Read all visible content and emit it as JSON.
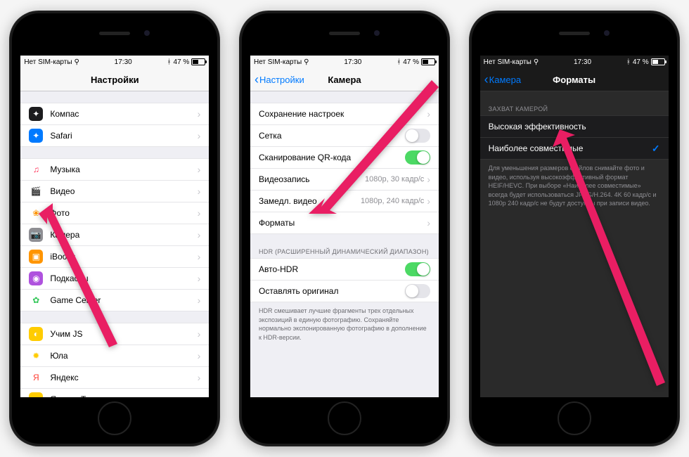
{
  "status": {
    "carrier": "Нет SIM-карты",
    "time": "17:30",
    "battery": "47 %",
    "wifi_icon": "wifi",
    "bt_icon": "bluetooth"
  },
  "phone1": {
    "title": "Настройки",
    "group1": [
      {
        "label": "Компас",
        "icon_bg": "#1c1c1e",
        "icon_glyph": "✦"
      },
      {
        "label": "Safari",
        "icon_bg": "#007aff",
        "icon_glyph": "✦"
      }
    ],
    "group2": [
      {
        "label": "Музыка",
        "icon_bg": "#ffffff",
        "icon_glyph": "♫",
        "icon_color": "#ff2d55"
      },
      {
        "label": "Видео",
        "icon_bg": "#ffffff",
        "icon_glyph": "🎬",
        "icon_color": "#000"
      },
      {
        "label": "Фото",
        "icon_bg": "#ffffff",
        "icon_glyph": "❀",
        "icon_color": "#ff9500"
      },
      {
        "label": "Камера",
        "icon_bg": "#8e8e93",
        "icon_glyph": "📷"
      },
      {
        "label": "iBooks",
        "icon_bg": "#ff9500",
        "icon_glyph": "▣"
      },
      {
        "label": "Подкасты",
        "icon_bg": "#af52de",
        "icon_glyph": "◉"
      },
      {
        "label": "Game Center",
        "icon_bg": "#ffffff",
        "icon_glyph": "✿",
        "icon_color": "#34c759"
      }
    ],
    "group3": [
      {
        "label": "Учим JS",
        "icon_bg": "#ffcc00",
        "icon_glyph": "◐"
      },
      {
        "label": "Юла",
        "icon_bg": "#ffffff",
        "icon_glyph": "✹",
        "icon_color": "#ffcc00"
      },
      {
        "label": "Яндекс",
        "icon_bg": "#ffffff",
        "icon_glyph": "Я",
        "icon_color": "#ff3b30"
      },
      {
        "label": "Яндекс Такси",
        "icon_bg": "#ffcc00",
        "icon_glyph": "▪"
      }
    ]
  },
  "phone2": {
    "back": "Настройки",
    "title": "Камера",
    "group1": [
      {
        "label": "Сохранение настроек",
        "type": "chevron"
      },
      {
        "label": "Сетка",
        "type": "switch",
        "on": false
      },
      {
        "label": "Сканирование QR-кода",
        "type": "switch",
        "on": true
      },
      {
        "label": "Видеозапись",
        "type": "value",
        "value": "1080p, 30 кадр/с"
      },
      {
        "label": "Замедл. видео",
        "type": "value",
        "value": "1080p, 240 кадр/с"
      },
      {
        "label": "Форматы",
        "type": "chevron"
      }
    ],
    "hdr_header": "HDR (РАСШИРЕННЫЙ ДИНАМИЧЕСКИЙ ДИАПАЗОН)",
    "group2": [
      {
        "label": "Авто-HDR",
        "type": "switch",
        "on": true
      },
      {
        "label": "Оставлять оригинал",
        "type": "switch",
        "on": false
      }
    ],
    "hdr_footer": "HDR смешивает лучшие фрагменты трех отдельных экспозиций в единую фотографию. Сохраняйте нормально экспонированную фотографию в дополнение к HDR-версии."
  },
  "phone3": {
    "back": "Камера",
    "title": "Форматы",
    "header": "ЗАХВАТ КАМЕРОЙ",
    "items": [
      {
        "label": "Высокая эффективность",
        "checked": false
      },
      {
        "label": "Наиболее совместимые",
        "checked": true
      }
    ],
    "footer": "Для уменьшения размеров файлов снимайте фото и видео, используя высокоэффективный формат HEIF/HEVC. При выборе «Наиболее совместимые» всегда будет использоваться JPEG/H.264. 4K 60 кадр/с и 1080p 240 кадр/с не будут доступны при записи видео."
  },
  "arrow_color": "#e91e63"
}
